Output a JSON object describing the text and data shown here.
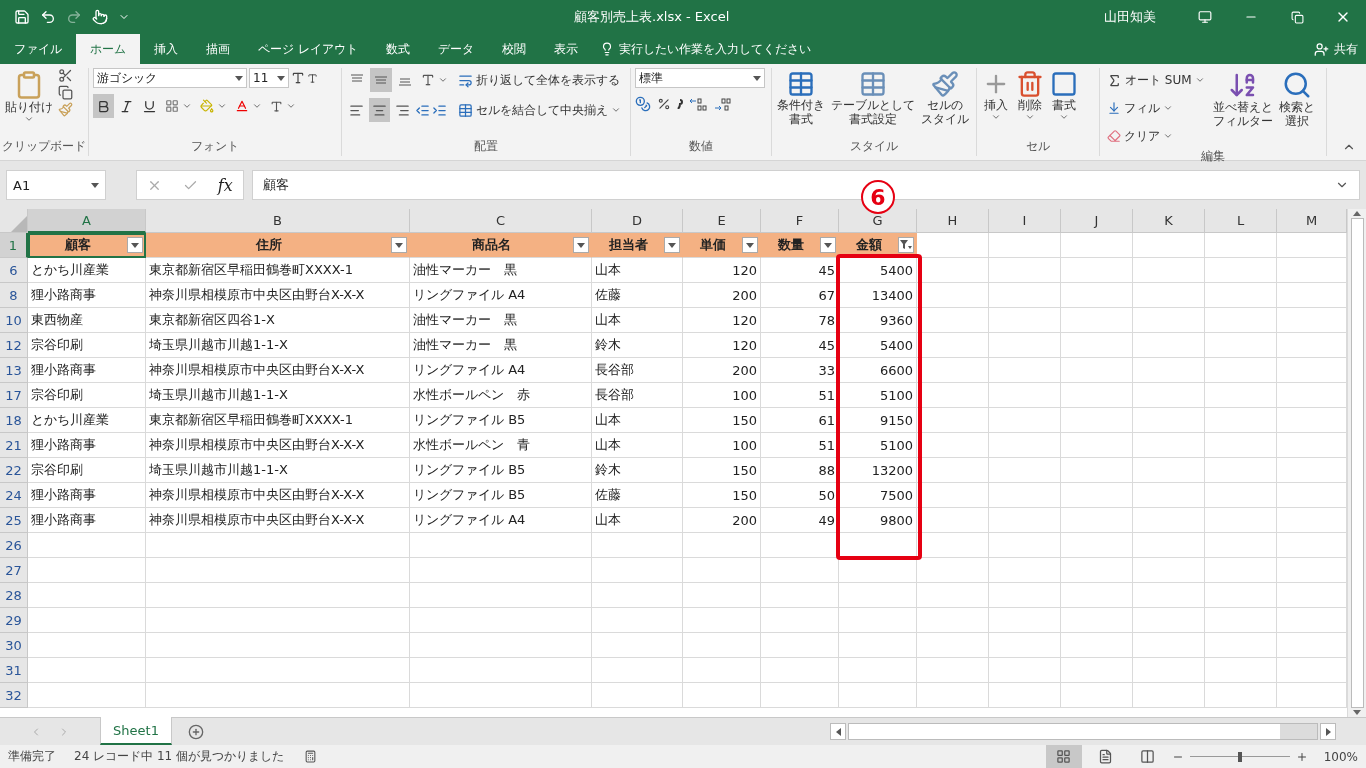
{
  "title_bar": {
    "title": "顧客別売上表.xlsx  -  Excel",
    "user": "山田知美"
  },
  "tabs": [
    {
      "label": "ファイル",
      "selected": false
    },
    {
      "label": "ホーム",
      "selected": true
    },
    {
      "label": "挿入",
      "selected": false
    },
    {
      "label": "描画",
      "selected": false
    },
    {
      "label": "ページ レイアウト",
      "selected": false
    },
    {
      "label": "数式",
      "selected": false
    },
    {
      "label": "データ",
      "selected": false
    },
    {
      "label": "校閲",
      "selected": false
    },
    {
      "label": "表示",
      "selected": false
    }
  ],
  "tell_me": "実行したい作業を入力してください",
  "share": "共有",
  "ribbon": {
    "clipboard": {
      "label": "クリップボード",
      "paste": "貼り付け"
    },
    "font": {
      "label": "フォント",
      "font_name": "游ゴシック",
      "font_size": "11",
      "toggles": [
        {
          "kind": "bold",
          "on": true
        },
        {
          "kind": "italic",
          "on": false
        },
        {
          "kind": "underline",
          "on": false
        }
      ]
    },
    "alignment": {
      "label": "配置",
      "vertical": [
        {
          "kind": "top",
          "on": false
        },
        {
          "kind": "middle",
          "on": true
        },
        {
          "kind": "bottom",
          "on": false
        }
      ],
      "horizontal": [
        {
          "kind": "left",
          "on": false
        },
        {
          "kind": "center",
          "on": true
        },
        {
          "kind": "right",
          "on": false
        }
      ],
      "wrap": "折り返して全体を表示する",
      "merge": "セルを結合して中央揃え"
    },
    "number": {
      "label": "数値",
      "format": "標準"
    },
    "styles": {
      "label": "スタイル",
      "buttons": [
        [
          "条件付き",
          "書式"
        ],
        [
          "テーブルとして",
          "書式設定"
        ],
        [
          "セルの",
          "スタイル"
        ]
      ]
    },
    "cells": {
      "label": "セル",
      "buttons": [
        "挿入",
        "削除",
        "書式"
      ]
    },
    "editing": {
      "label": "編集",
      "autosum": "オート SUM",
      "fill": "フィル",
      "clear": "クリア",
      "buttons": [
        [
          "並べ替えと",
          "フィルター"
        ],
        [
          "検索と",
          "選択"
        ]
      ]
    }
  },
  "formula_bar": {
    "name_box": "A1",
    "fx_label": "fx",
    "formula": "顧客"
  },
  "columns": [
    {
      "letter": "A",
      "selected": true
    },
    {
      "letter": "B",
      "selected": false
    },
    {
      "letter": "C",
      "selected": false
    },
    {
      "letter": "D",
      "selected": false
    },
    {
      "letter": "E",
      "selected": false
    },
    {
      "letter": "F",
      "selected": false
    },
    {
      "letter": "G",
      "selected": false
    },
    {
      "letter": "H",
      "selected": false
    },
    {
      "letter": "I",
      "selected": false
    },
    {
      "letter": "J",
      "selected": false
    },
    {
      "letter": "K",
      "selected": false
    },
    {
      "letter": "L",
      "selected": false
    },
    {
      "letter": "M",
      "selected": false
    }
  ],
  "header_row": {
    "num": "1",
    "selected": true,
    "cells": [
      {
        "label": "顧客",
        "filtered": false
      },
      {
        "label": "住所",
        "filtered": false
      },
      {
        "label": "商品名",
        "filtered": false
      },
      {
        "label": "担当者",
        "filtered": false
      },
      {
        "label": "単価",
        "filtered": false
      },
      {
        "label": "数量",
        "filtered": false
      },
      {
        "label": "金額",
        "filtered": true
      }
    ]
  },
  "rows": [
    {
      "num": "6",
      "cells": [
        "とかち川産業",
        "東京都新宿区早稲田鶴巻町XXXX-1",
        "油性マーカー　黒",
        "山本",
        "120",
        "45",
        "5400"
      ]
    },
    {
      "num": "8",
      "cells": [
        "狸小路商事",
        "神奈川県相模原市中央区由野台X-X-X",
        "リングファイル A4",
        "佐藤",
        "200",
        "67",
        "13400"
      ]
    },
    {
      "num": "10",
      "cells": [
        "東西物産",
        "東京都新宿区四谷1-X",
        "油性マーカー　黒",
        "山本",
        "120",
        "78",
        "9360"
      ]
    },
    {
      "num": "12",
      "cells": [
        "宗谷印刷",
        "埼玉県川越市川越1-1-X",
        "油性マーカー　黒",
        "鈴木",
        "120",
        "45",
        "5400"
      ]
    },
    {
      "num": "13",
      "cells": [
        "狸小路商事",
        "神奈川県相模原市中央区由野台X-X-X",
        "リングファイル A4",
        "長谷部",
        "200",
        "33",
        "6600"
      ]
    },
    {
      "num": "17",
      "cells": [
        "宗谷印刷",
        "埼玉県川越市川越1-1-X",
        "水性ボールペン　赤",
        "長谷部",
        "100",
        "51",
        "5100"
      ]
    },
    {
      "num": "18",
      "cells": [
        "とかち川産業",
        "東京都新宿区早稲田鶴巻町XXXX-1",
        "リングファイル B5",
        "山本",
        "150",
        "61",
        "9150"
      ]
    },
    {
      "num": "21",
      "cells": [
        "狸小路商事",
        "神奈川県相模原市中央区由野台X-X-X",
        "水性ボールペン　青",
        "山本",
        "100",
        "51",
        "5100"
      ]
    },
    {
      "num": "22",
      "cells": [
        "宗谷印刷",
        "埼玉県川越市川越1-1-X",
        "リングファイル B5",
        "鈴木",
        "150",
        "88",
        "13200"
      ]
    },
    {
      "num": "24",
      "cells": [
        "狸小路商事",
        "神奈川県相模原市中央区由野台X-X-X",
        "リングファイル B5",
        "佐藤",
        "150",
        "50",
        "7500"
      ]
    },
    {
      "num": "25",
      "cells": [
        "狸小路商事",
        "神奈川県相模原市中央区由野台X-X-X",
        "リングファイル A4",
        "山本",
        "200",
        "49",
        "9800"
      ]
    }
  ],
  "empty_rows": [
    "26",
    "27",
    "28",
    "29",
    "30",
    "31",
    "32"
  ],
  "annotation": {
    "label": "6"
  },
  "sheet_tabs": [
    {
      "label": "Sheet1",
      "selected": true
    }
  ],
  "status_bar": {
    "ready": "準備完了",
    "message": "24 レコード中 11 個が見つかりました",
    "views": [
      {
        "kind": "normal",
        "selected": true
      },
      {
        "kind": "page_layout",
        "selected": false
      },
      {
        "kind": "page_break",
        "selected": false
      }
    ],
    "zoom": {
      "level": 0.5
    },
    "zoom_text": "100%"
  }
}
